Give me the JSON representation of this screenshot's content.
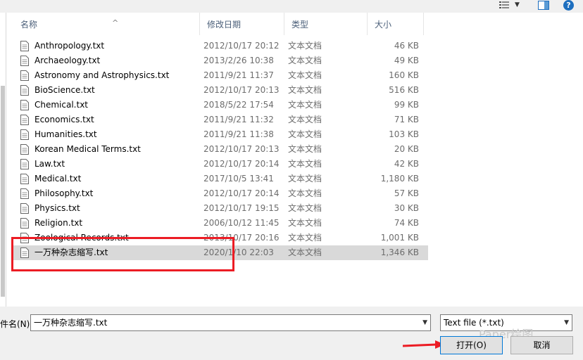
{
  "toolbar": {
    "view_icon": "view-list-icon",
    "pane_icon": "preview-pane-icon",
    "help_icon": "help-icon",
    "help_label": "?"
  },
  "columns": {
    "name": "名称",
    "date": "修改日期",
    "type": "类型",
    "size": "大小"
  },
  "files": [
    {
      "name": "Anthropology.txt",
      "date": "2012/10/17 20:12",
      "type": "文本文档",
      "size": "46 KB"
    },
    {
      "name": "Archaeology.txt",
      "date": "2013/2/26 10:38",
      "type": "文本文档",
      "size": "49 KB"
    },
    {
      "name": "Astronomy and Astrophysics.txt",
      "date": "2011/9/21 11:37",
      "type": "文本文档",
      "size": "160 KB"
    },
    {
      "name": "BioScience.txt",
      "date": "2012/10/17 20:13",
      "type": "文本文档",
      "size": "516 KB"
    },
    {
      "name": "Chemical.txt",
      "date": "2018/5/22 17:54",
      "type": "文本文档",
      "size": "99 KB"
    },
    {
      "name": "Economics.txt",
      "date": "2011/9/21 11:32",
      "type": "文本文档",
      "size": "71 KB"
    },
    {
      "name": "Humanities.txt",
      "date": "2011/9/21 11:38",
      "type": "文本文档",
      "size": "103 KB"
    },
    {
      "name": "Korean Medical Terms.txt",
      "date": "2012/10/17 20:13",
      "type": "文本文档",
      "size": "20 KB"
    },
    {
      "name": "Law.txt",
      "date": "2012/10/17 20:14",
      "type": "文本文档",
      "size": "42 KB"
    },
    {
      "name": "Medical.txt",
      "date": "2017/10/5 13:41",
      "type": "文本文档",
      "size": "1,180 KB"
    },
    {
      "name": "Philosophy.txt",
      "date": "2012/10/17 20:14",
      "type": "文本文档",
      "size": "57 KB"
    },
    {
      "name": "Physics.txt",
      "date": "2012/10/17 19:15",
      "type": "文本文档",
      "size": "30 KB"
    },
    {
      "name": "Religion.txt",
      "date": "2006/10/12 11:45",
      "type": "文本文档",
      "size": "74 KB"
    },
    {
      "name": "Zoological Records.txt",
      "date": "2013/10/17 20:16",
      "type": "文本文档",
      "size": "1,001 KB"
    },
    {
      "name": "一万种杂志缩写.txt",
      "date": "2020/1/10 22:03",
      "type": "文本文档",
      "size": "1,346 KB",
      "selected": true
    }
  ],
  "bottom": {
    "filename_label": "件名(N):",
    "filename_value": "一万种杂志缩写.txt",
    "filetype_value": "Text file (*.txt)",
    "open_label": "打开(O)",
    "cancel_label": "取消",
    "watermark": "Paper绘图"
  },
  "colors": {
    "highlight": "#ec1c24",
    "selected_row": "#d9d9d9",
    "header_text": "#4c607a"
  }
}
